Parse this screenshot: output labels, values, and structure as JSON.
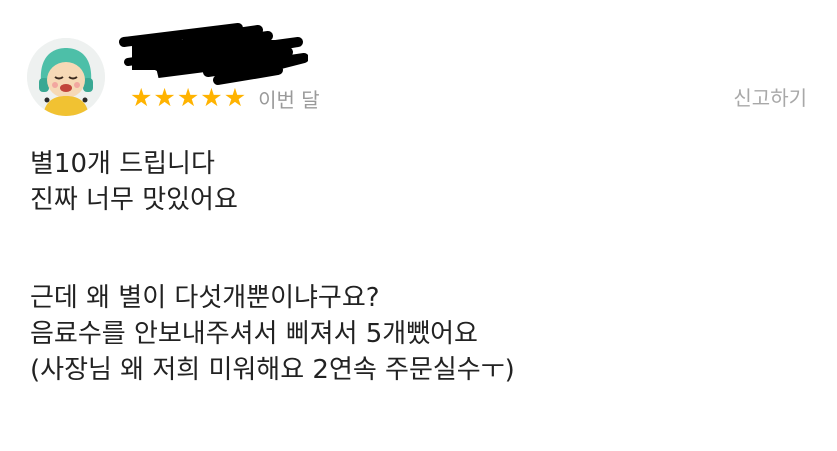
{
  "review": {
    "rating": 5,
    "stars": [
      "★",
      "★",
      "★",
      "★",
      "★"
    ],
    "date": "이번 달",
    "report_label": "신고하기",
    "lines_first": [
      "별10개 드립니다",
      "진짜 너무 맛있어요"
    ],
    "lines_second": [
      "근데 왜 별이 다섯개뿐이냐구요?",
      "음료수를 안보내주셔서 삐져서 5개뺐어요",
      "(사장님 왜 저희 미워해요 2연속 주문실수ㅜ)"
    ]
  },
  "colors": {
    "star": "#ffb300",
    "meta_text": "#9a9a9a",
    "body_text": "#222222"
  },
  "icons": {
    "avatar": "cartoon-face-avatar",
    "redaction": "scribble-redaction"
  }
}
